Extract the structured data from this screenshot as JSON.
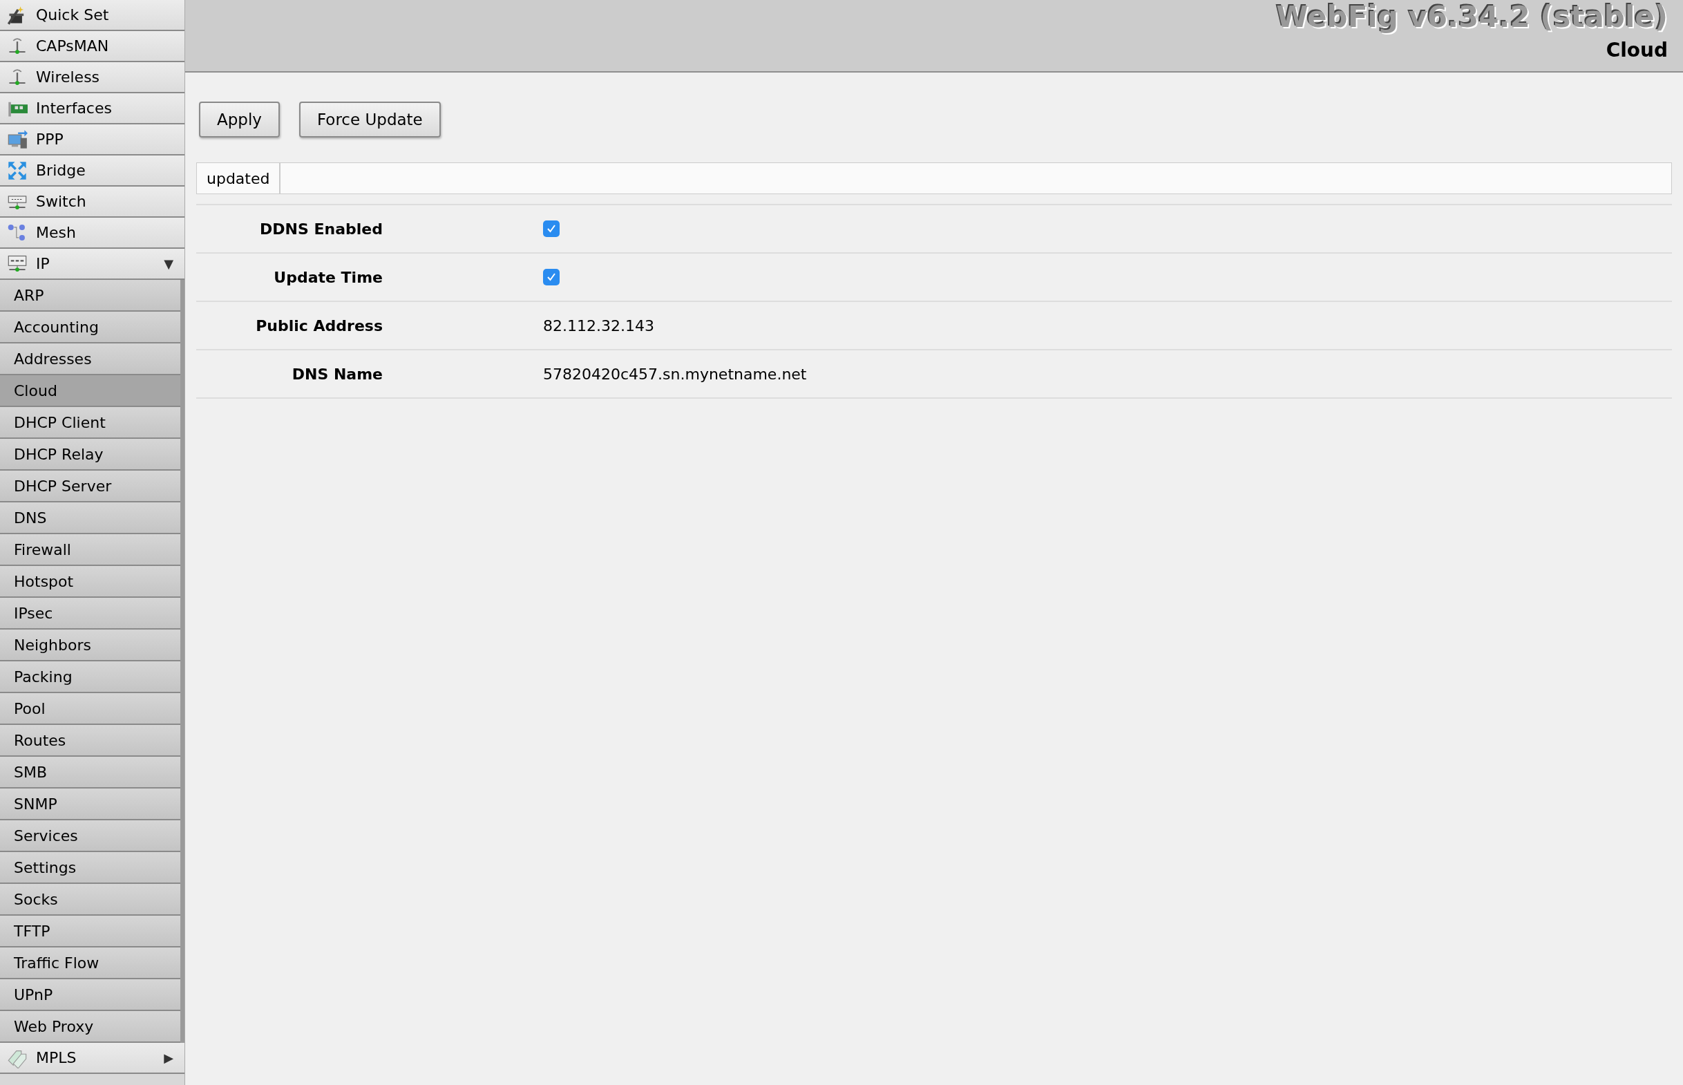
{
  "header": {
    "title": "WebFig v6.34.2 (stable)",
    "page": "Cloud"
  },
  "menu": [
    {
      "label": "Quick Set",
      "selected": false
    },
    {
      "label": "CAPsMAN",
      "selected": false
    },
    {
      "label": "Wireless",
      "selected": false
    },
    {
      "label": "Interfaces",
      "selected": false
    },
    {
      "label": "PPP",
      "selected": false
    },
    {
      "label": "Bridge",
      "selected": false
    },
    {
      "label": "Switch",
      "selected": false
    },
    {
      "label": "Mesh",
      "selected": false
    },
    {
      "label": "IP",
      "selected": false,
      "expander": "▼",
      "expanded": true,
      "children": [
        {
          "label": "ARP",
          "selected": false
        },
        {
          "label": "Accounting",
          "selected": false
        },
        {
          "label": "Addresses",
          "selected": false
        },
        {
          "label": "Cloud",
          "selected": true
        },
        {
          "label": "DHCP Client",
          "selected": false
        },
        {
          "label": "DHCP Relay",
          "selected": false
        },
        {
          "label": "DHCP Server",
          "selected": false
        },
        {
          "label": "DNS",
          "selected": false
        },
        {
          "label": "Firewall",
          "selected": false
        },
        {
          "label": "Hotspot",
          "selected": false
        },
        {
          "label": "IPsec",
          "selected": false
        },
        {
          "label": "Neighbors",
          "selected": false
        },
        {
          "label": "Packing",
          "selected": false
        },
        {
          "label": "Pool",
          "selected": false
        },
        {
          "label": "Routes",
          "selected": false
        },
        {
          "label": "SMB",
          "selected": false
        },
        {
          "label": "SNMP",
          "selected": false
        },
        {
          "label": "Services",
          "selected": false
        },
        {
          "label": "Settings",
          "selected": false
        },
        {
          "label": "Socks",
          "selected": false
        },
        {
          "label": "TFTP",
          "selected": false
        },
        {
          "label": "Traffic Flow",
          "selected": false
        },
        {
          "label": "UPnP",
          "selected": false
        },
        {
          "label": "Web Proxy",
          "selected": false
        }
      ]
    },
    {
      "label": "MPLS",
      "selected": false,
      "expander": "▶",
      "expanded": false
    }
  ],
  "buttons": [
    "Apply",
    "Force Update"
  ],
  "status": "updated",
  "fields": [
    {
      "kind": "checkbox",
      "label": "DDNS Enabled",
      "checked": true
    },
    {
      "kind": "checkbox",
      "label": "Update Time",
      "checked": true
    },
    {
      "kind": "text",
      "label": "Public Address",
      "value": "82.112.32.143"
    },
    {
      "kind": "text",
      "label": "DNS Name",
      "value": "57820420c457.sn.mynetname.net"
    }
  ]
}
